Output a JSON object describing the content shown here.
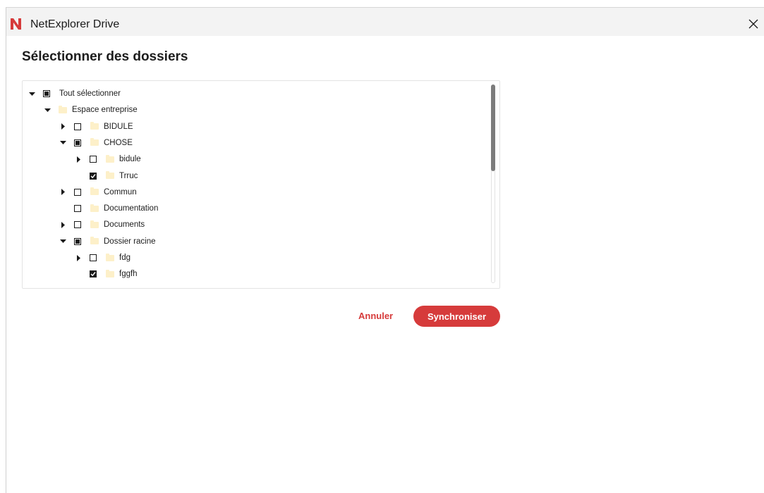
{
  "window": {
    "title": "NetExplorer Drive",
    "accent_color": "#d63b3b",
    "logo_color": "#d63b3b"
  },
  "dialog": {
    "title": "Sélectionner des dossiers"
  },
  "tree": {
    "rows": [
      {
        "label": "Tout sélectionner",
        "level": 0,
        "arrow": "down",
        "checkbox": "partial",
        "folder": false
      },
      {
        "label": "Espace entreprise",
        "level": 1,
        "arrow": "down",
        "checkbox": "none",
        "folder": true
      },
      {
        "label": "BIDULE",
        "level": 2,
        "arrow": "right",
        "checkbox": "unchecked",
        "folder": true
      },
      {
        "label": "CHOSE",
        "level": 2,
        "arrow": "down",
        "checkbox": "partial",
        "folder": true
      },
      {
        "label": "bidule",
        "level": 3,
        "arrow": "right",
        "checkbox": "unchecked",
        "folder": true
      },
      {
        "label": "Trruc",
        "level": 3,
        "arrow": "none",
        "checkbox": "checked",
        "folder": true
      },
      {
        "label": "Commun",
        "level": 2,
        "arrow": "right",
        "checkbox": "unchecked",
        "folder": true
      },
      {
        "label": "Documentation",
        "level": 2,
        "arrow": "none",
        "checkbox": "unchecked",
        "folder": true
      },
      {
        "label": "Documents",
        "level": 2,
        "arrow": "right",
        "checkbox": "unchecked",
        "folder": true
      },
      {
        "label": "Dossier racine",
        "level": 2,
        "arrow": "down",
        "checkbox": "partial",
        "folder": true
      },
      {
        "label": "fdg",
        "level": 3,
        "arrow": "right",
        "checkbox": "unchecked",
        "folder": true
      },
      {
        "label": "fggfh",
        "level": 3,
        "arrow": "none",
        "checkbox": "checked",
        "folder": true
      }
    ]
  },
  "actions": {
    "cancel_label": "Annuler",
    "sync_label": "Synchroniser"
  }
}
